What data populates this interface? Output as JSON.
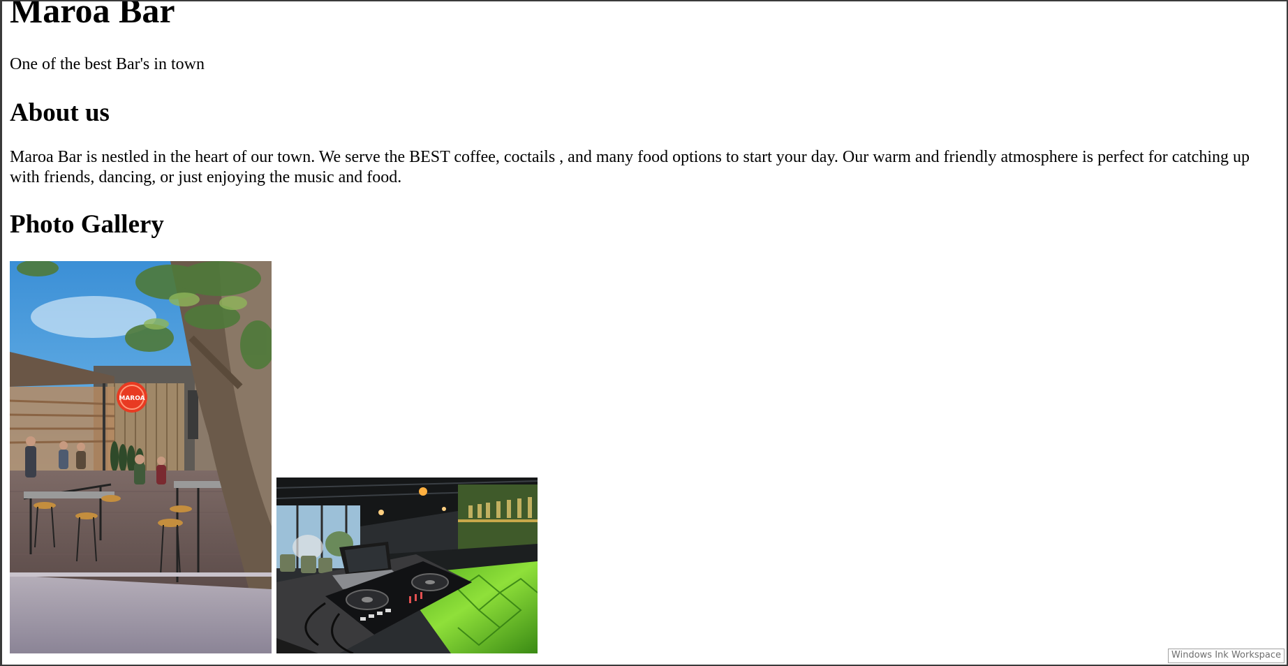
{
  "site": {
    "title": "Maroa Bar",
    "tagline": "One of the best Bar's in town"
  },
  "about": {
    "heading": "About us",
    "text": "Maroa Bar is nestled in the heart of our town. We serve the BEST coffee, coctails , and many food options to start your day. Our warm and friendly atmosphere is perfect for catching up with friends, dancing, or just enjoying the music and food."
  },
  "gallery": {
    "heading": "Photo Gallery",
    "photos": [
      {
        "sign_text": "MAROA"
      },
      {}
    ]
  },
  "taskbar": {
    "ink_workspace_label": "Windows Ink Workspace"
  }
}
